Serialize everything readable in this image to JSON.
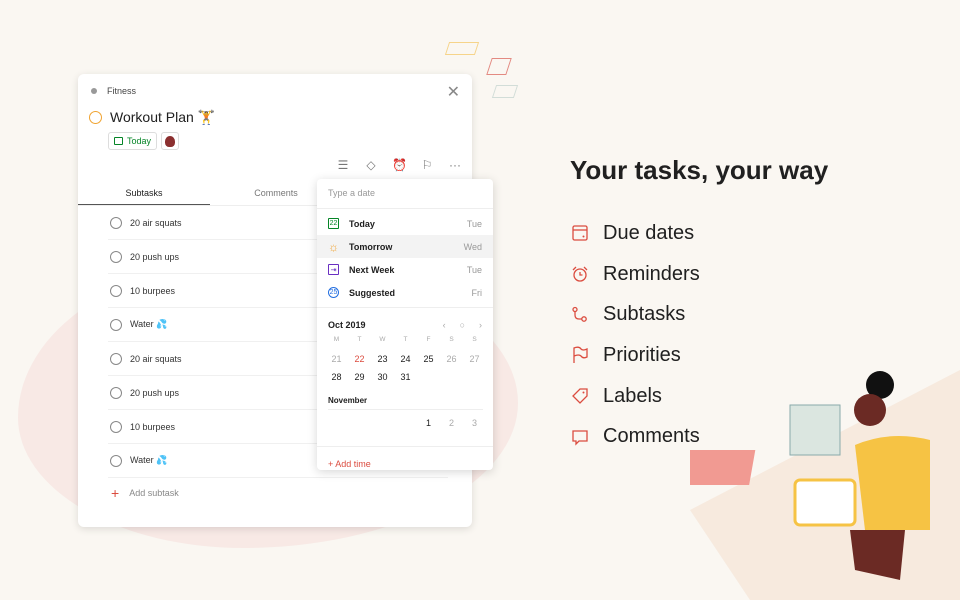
{
  "task": {
    "project": "Fitness",
    "title": "Workout Plan 🏋️",
    "due_chip": "Today",
    "tabs": [
      "Subtasks",
      "Comments"
    ],
    "active_tab": "Subtasks",
    "subtasks": [
      "20 air squats",
      "20 push ups",
      "10 burpees",
      "Water 💦",
      "20 air squats",
      "20 push ups",
      "10 burpees",
      "Water 💦"
    ],
    "add_subtask_label": "Add subtask"
  },
  "date_picker": {
    "placeholder": "Type a date",
    "options": [
      {
        "label": "Today",
        "day": "Tue",
        "icon": "calendar-today-icon",
        "glyph": "22"
      },
      {
        "label": "Tomorrow",
        "day": "Wed",
        "icon": "sun-icon",
        "glyph": "☼"
      },
      {
        "label": "Next Week",
        "day": "Tue",
        "icon": "next-week-icon",
        "glyph": "⇥"
      },
      {
        "label": "Suggested",
        "day": "Fri",
        "icon": "suggested-icon",
        "glyph": "25"
      }
    ],
    "hovered": "Tomorrow",
    "month_label": "Oct 2019",
    "weekdays": [
      "M",
      "T",
      "W",
      "T",
      "F",
      "S",
      "S"
    ],
    "oct_days": [
      "21",
      "22",
      "23",
      "24",
      "25",
      "26",
      "27",
      "28",
      "29",
      "30",
      "31"
    ],
    "selected_day": "22",
    "next_month_label": "November",
    "nov_days": [
      "1",
      "2",
      "3"
    ],
    "add_time_label": "+ Add time"
  },
  "promo": {
    "headline": "Your tasks, your way",
    "features": [
      "Due dates",
      "Reminders",
      "Subtasks",
      "Priorities",
      "Labels",
      "Comments"
    ]
  },
  "colors": {
    "accent": "#db4c3f",
    "today_green": "#058527",
    "priority_orange": "#f0a432",
    "next_week_purple": "#692fc2",
    "suggested_blue": "#246fe0"
  }
}
